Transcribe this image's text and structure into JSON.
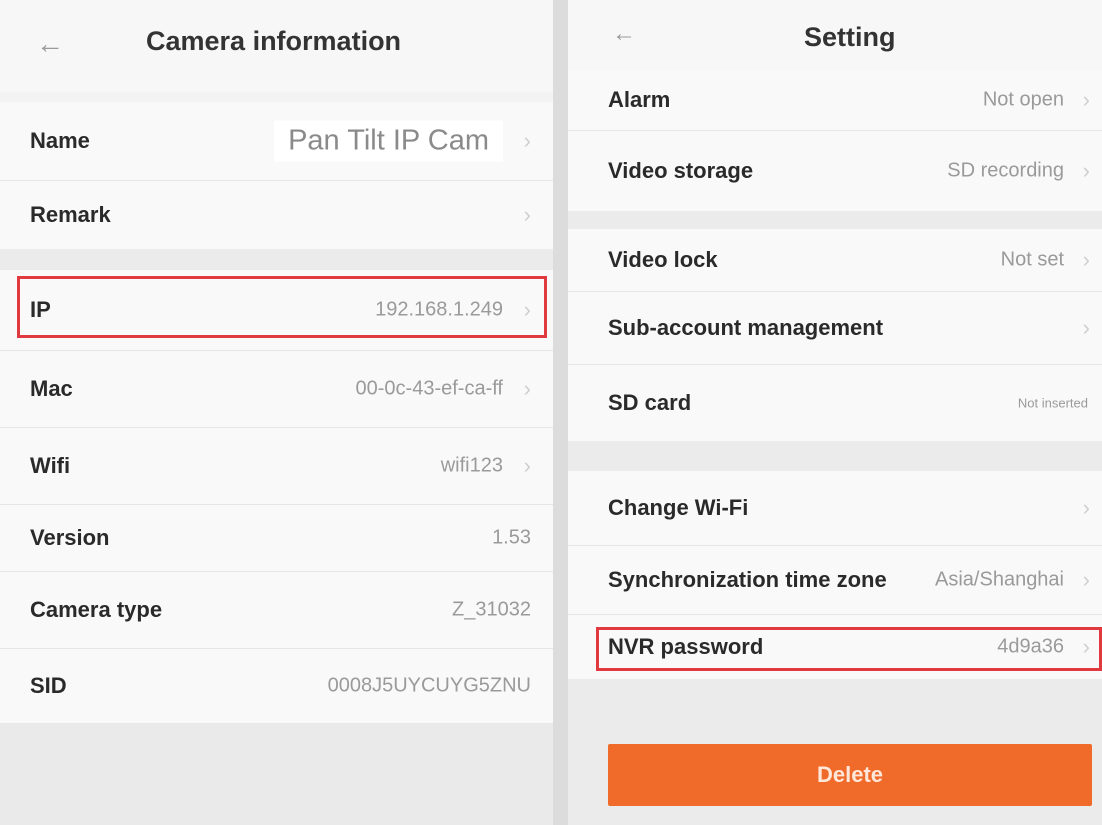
{
  "left": {
    "back_icon": "←",
    "title": "Camera information",
    "rows": [
      {
        "label": "Name",
        "value": "Pan Tilt IP Cam"
      },
      {
        "label": "Remark",
        "value": ""
      },
      {
        "label": "IP",
        "value": "192.168.1.249"
      },
      {
        "label": "Mac",
        "value": "00-0c-43-ef-ca-ff"
      },
      {
        "label": "Wifi",
        "value": "wifi123"
      },
      {
        "label": "Version",
        "value": "1.53"
      },
      {
        "label": "Camera type",
        "value": "Z_31032"
      },
      {
        "label": "SID",
        "value": "0008J5UYCUYG5ZNU"
      }
    ]
  },
  "right": {
    "back_icon": "←",
    "title": "Setting",
    "rows": [
      {
        "label": "Alarm",
        "value": "Not open"
      },
      {
        "label": "Video storage",
        "value": "SD recording"
      },
      {
        "label": "Video lock",
        "value": "Not set"
      },
      {
        "label": "Sub-account management",
        "value": ""
      },
      {
        "label": "SD card",
        "value": "Not inserted"
      },
      {
        "label": "Change Wi-Fi",
        "value": ""
      },
      {
        "label": "Synchronization time zone",
        "value": "Asia/Shanghai"
      },
      {
        "label": "NVR password",
        "value": "4d9a36"
      }
    ],
    "delete_label": "Delete"
  },
  "icons": {
    "chevron": "chevron-right-icon",
    "back": "arrow-left-icon"
  },
  "colors": {
    "highlight": "#e03a40",
    "delete_button": "#f06a2a"
  }
}
